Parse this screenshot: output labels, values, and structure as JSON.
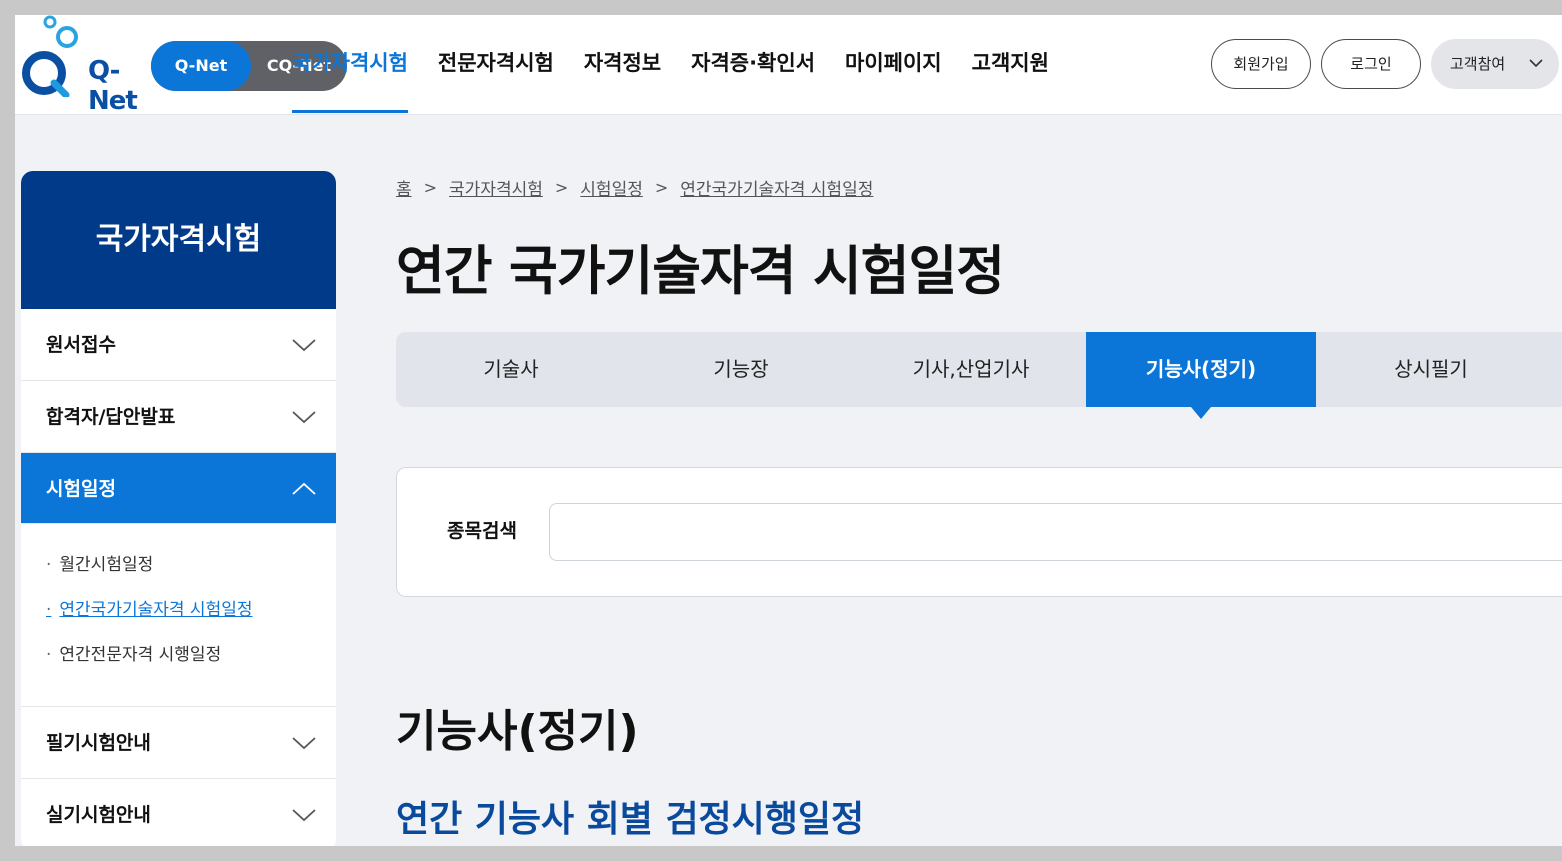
{
  "header": {
    "logo_text": "Q-Net",
    "switch_on": "Q-Net",
    "switch_off": "CQ-Net",
    "gnb": [
      "국가자격시험",
      "전문자격시험",
      "자격정보",
      "자격증·확인서",
      "마이페이지",
      "고객지원"
    ],
    "join": "회원가입",
    "login": "로그인",
    "participate": "고객참여"
  },
  "sidebar": {
    "title": "국가자격시험",
    "items": [
      {
        "label": "원서접수"
      },
      {
        "label": "합격자/답안발표"
      },
      {
        "label": "시험일정"
      },
      {
        "label": "필기시험안내"
      },
      {
        "label": "실기시험안내"
      }
    ],
    "sub": [
      "월간시험일정",
      "연간국가기술자격 시험일정",
      "연간전문자격 시행일정"
    ]
  },
  "breadcrumb": [
    "홈",
    "국가자격시험",
    "시험일정",
    "연간국가기술자격 시험일정"
  ],
  "page_title": "연간 국가기술자격 시험일정",
  "tabs": [
    "기술사",
    "기능장",
    "기사,산업기사",
    "기능사(정기)",
    "상시필기"
  ],
  "search": {
    "label": "종목검색",
    "value": "",
    "placeholder": ""
  },
  "section_title": "기능사(정기)",
  "section_subtitle": "연간 기능사 회별 검정시행일정",
  "colors": {
    "primary": "#0b76d8",
    "navy": "#003a88",
    "subtitle": "#0a4a9c"
  }
}
